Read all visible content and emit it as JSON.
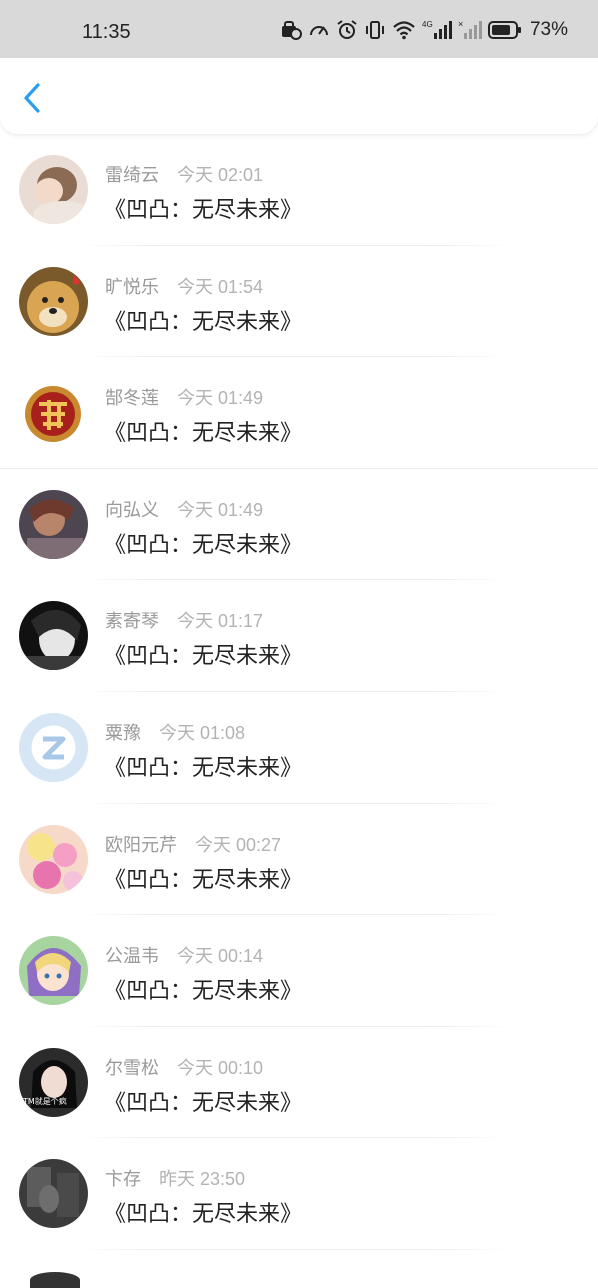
{
  "status_bar": {
    "time": "11:35",
    "battery_pct": "73%",
    "network_label": "4G"
  },
  "nav": {
    "back_icon": "chevron-left-icon",
    "accent_color": "#2c9cf0"
  },
  "comments": [
    {
      "name": "雷绮云",
      "time": "今天 02:01",
      "message": "《凹凸：无尽未来》",
      "avatar": "photo-girl"
    },
    {
      "name": "旷悦乐",
      "time": "今天 01:54",
      "message": "《凹凸：无尽未来》",
      "avatar": "doge"
    },
    {
      "name": "郜冬莲",
      "time": "今天 01:49",
      "message": "《凹凸：无尽未来》",
      "avatar": "fu-character"
    },
    {
      "name": "向弘义",
      "time": "今天 01:49",
      "message": "《凹凸：无尽未来》",
      "avatar": "anime-dark"
    },
    {
      "name": "素寄琴",
      "time": "今天 01:17",
      "message": "《凹凸：无尽未来》",
      "avatar": "bw-portrait"
    },
    {
      "name": "粟豫",
      "time": "今天 01:08",
      "message": "《凹凸：无尽未来》",
      "avatar": "default-qq"
    },
    {
      "name": "欧阳元芹",
      "time": "今天 00:27",
      "message": "《凹凸：无尽未来》",
      "avatar": "flowers"
    },
    {
      "name": "公温韦",
      "time": "今天 00:14",
      "message": "《凹凸：无尽未来》",
      "avatar": "anime-girl"
    },
    {
      "name": "尔雪松",
      "time": "今天 00:10",
      "message": "《凹凸：无尽未来》",
      "avatar": "photo-woman",
      "avatar_caption": "TM就是个疯"
    },
    {
      "name": "卞存",
      "time": "昨天 23:50",
      "message": "《凹凸：无尽未来》",
      "avatar": "dark-photo"
    }
  ]
}
